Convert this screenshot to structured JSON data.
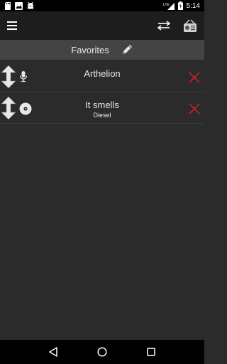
{
  "status_bar": {
    "time": "5:14",
    "network_label": "LTE",
    "icons": [
      "sd-card-icon",
      "android-debug-icon",
      "lte-signal-icon",
      "battery-charging-icon"
    ]
  },
  "app_bar": {
    "icons": [
      "menu-icon",
      "swap-icon",
      "radio-icon"
    ]
  },
  "favorites": {
    "title": "Favorites",
    "edit_icon": "pencil-icon"
  },
  "items": [
    {
      "title": "Arthelion",
      "subtitle": "",
      "type_icon": "microphone-icon"
    },
    {
      "title": "It smells",
      "subtitle": "Diesel",
      "type_icon": "disc-icon"
    }
  ],
  "colors": {
    "status_bar_bg": "#000000",
    "app_bar_bg": "#1d1d1d",
    "header_bg": "#444444",
    "list_bg": "#2b2b2b",
    "delete_red": "#cc2222"
  },
  "nav_bar": {
    "icons": [
      "back-icon",
      "home-icon",
      "recents-icon"
    ]
  }
}
